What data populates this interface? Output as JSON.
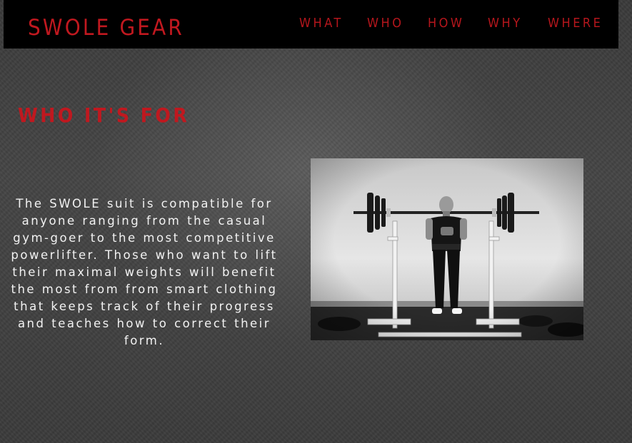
{
  "header": {
    "brand": "SWOLE GEAR",
    "nav": [
      {
        "label": "WHAT"
      },
      {
        "label": "WHO"
      },
      {
        "label": "HOW"
      },
      {
        "label": "WHY"
      },
      {
        "label": "WHERE"
      }
    ]
  },
  "main": {
    "title": "WHO IT'S FOR",
    "description": "The SWOLE suit is compatible for anyone ranging from the casual gym-goer to the most competitive powerlifter. Those who want to lift their maximal weights will benefit the most from from smart clothing that keeps track of their progress and teaches how to correct their form.",
    "photo": {
      "subject": "powerlifter-at-squat-rack"
    }
  },
  "colors": {
    "accent": "#c0181f",
    "nav_bg": "#000000",
    "page_bg": "#424242",
    "body_text": "#f2f2f2"
  }
}
